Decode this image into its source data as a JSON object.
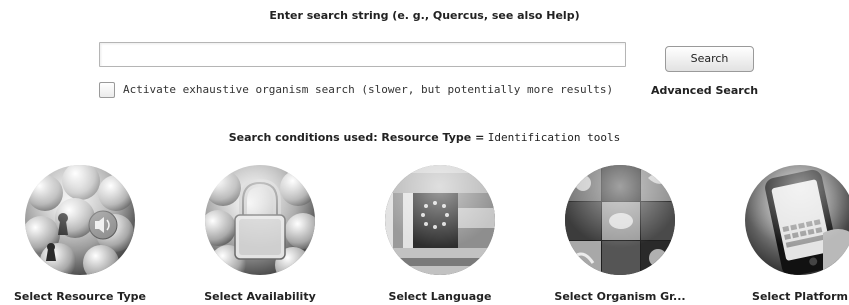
{
  "search": {
    "prompt": "Enter search string (e. g., Quercus, see also Help)",
    "value": "",
    "button_label": "Search"
  },
  "options": {
    "exhaustive_label": "Activate exhaustive organism search (slower, but potentially more results)",
    "exhaustive_checked": false,
    "advanced_search_label": "Advanced Search"
  },
  "conditions": {
    "prefix": "Search conditions used: Resource Type =",
    "value": "Identification tools"
  },
  "filters": [
    {
      "label": "Select Resource Type",
      "icon": "resource-type-icon"
    },
    {
      "label": "Select Availability",
      "icon": "padlock-icon"
    },
    {
      "label": "Select Language",
      "icon": "flags-icon"
    },
    {
      "label": "Select Organism Gr...",
      "icon": "organism-photos-icon"
    },
    {
      "label": "Select Platform",
      "icon": "smartphone-icon"
    }
  ],
  "colors": {
    "text": "#222222",
    "border": "#9a9a9a",
    "background": "#ffffff"
  }
}
